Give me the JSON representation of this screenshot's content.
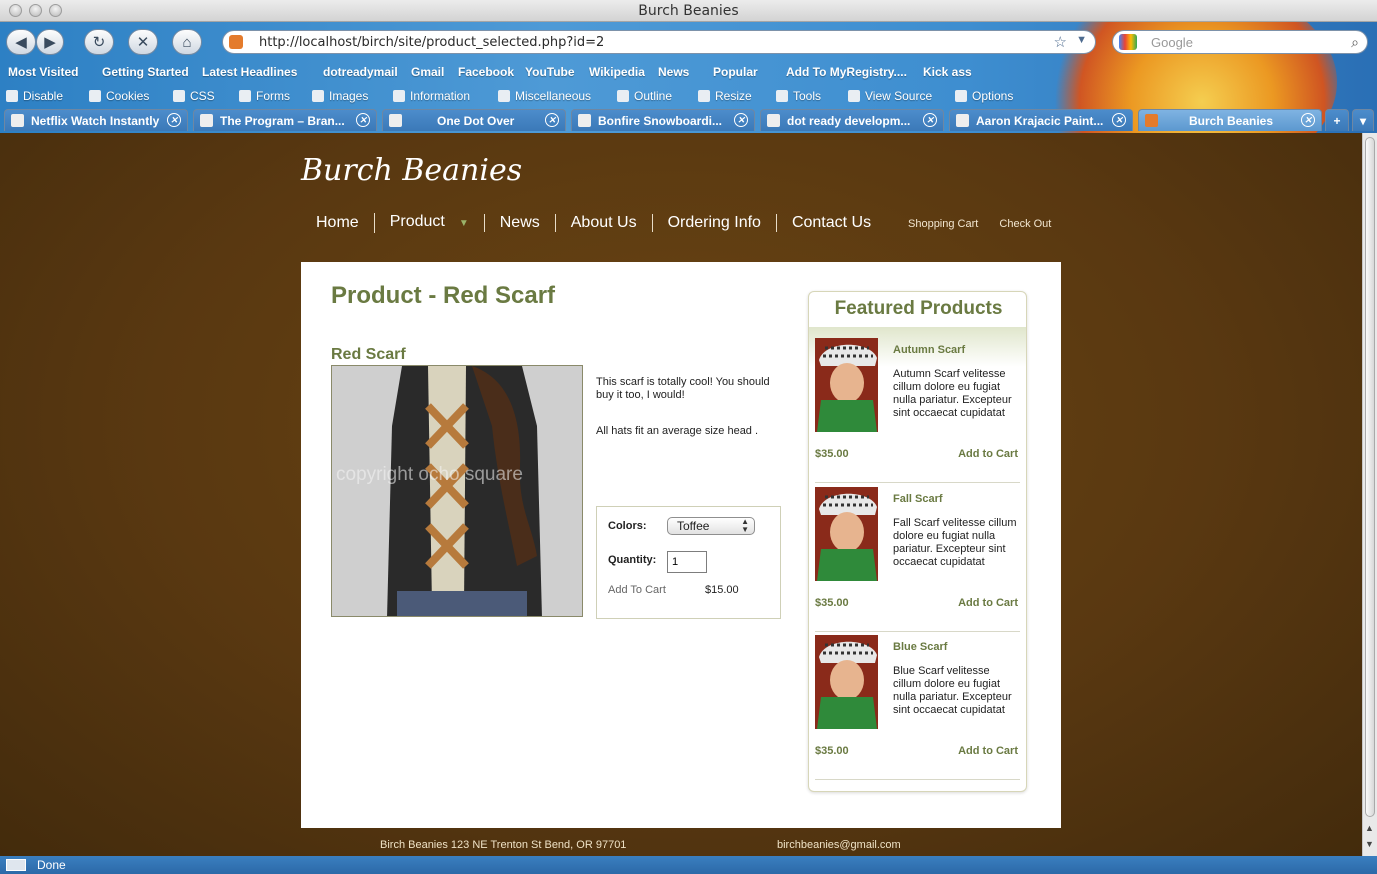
{
  "window": {
    "title": "Burch Beanies"
  },
  "toolbar": {
    "back": "◀",
    "forward": "▶",
    "reload": "↻",
    "stop": "✕",
    "home": "⌂",
    "url": "http://localhost/birch/site/product_selected.php?id=2",
    "search_placeholder": "Google"
  },
  "bookmarks": [
    "Most Visited",
    "Getting Started",
    "Latest Headlines",
    "dotreadymail",
    "Gmail",
    "Facebook",
    "YouTube",
    "Wikipedia",
    "News",
    "Popular",
    "Add To MyRegistry....",
    "Kick ass"
  ],
  "devtools": [
    "Disable",
    "Cookies",
    "CSS",
    "Forms",
    "Images",
    "Information",
    "Miscellaneous",
    "Outline",
    "Resize",
    "Tools",
    "View Source",
    "Options"
  ],
  "tabs": [
    "Netflix Watch Instantly",
    "The Program – Bran...",
    "One Dot Over",
    "Bonfire Snowboardi...",
    "dot ready developm...",
    "Aaron Krajacic Paint...",
    "Burch Beanies"
  ],
  "site": {
    "brand": "Burch Beanies",
    "nav": [
      "Home",
      "Product",
      "News",
      "About Us",
      "Ordering Info",
      "Contact Us"
    ],
    "cart_links": [
      "Shopping Cart",
      "Check Out"
    ],
    "heading": "Product - Red Scarf",
    "product_name": "Red Scarf",
    "image_watermark": "copyright ocho square",
    "desc1": "This scarf is totally cool! You should buy it too, I would!",
    "desc2": "All hats fit an average size head .",
    "order": {
      "colors_label": "Colors:",
      "color_value": "Toffee",
      "quantity_label": "Quantity:",
      "quantity_value": "1",
      "add_to_cart": "Add To Cart",
      "price": "$15.00"
    },
    "featured": {
      "title": "Featured Products",
      "items": [
        {
          "name": "Autumn Scarf",
          "text": "Autumn Scarf velitesse cillum dolore eu fugiat nulla pariatur. Excepteur sint occaecat cupidatat",
          "price": "$35.00",
          "add": "Add to Cart"
        },
        {
          "name": "Fall Scarf",
          "text": "Fall Scarf velitesse cillum dolore eu fugiat nulla pariatur. Excepteur sint occaecat cupidatat",
          "price": "$35.00",
          "add": "Add to Cart"
        },
        {
          "name": "Blue Scarf",
          "text": "Blue Scarf velitesse cillum dolore eu fugiat nulla pariatur. Excepteur sint occaecat cupidatat",
          "price": "$35.00",
          "add": "Add to Cart"
        }
      ]
    },
    "footer_address": "Birch Beanies 123 NE Trenton St Bend, OR 97701",
    "footer_email": "birchbeanies@gmail.com"
  },
  "status": {
    "text": "Done"
  }
}
